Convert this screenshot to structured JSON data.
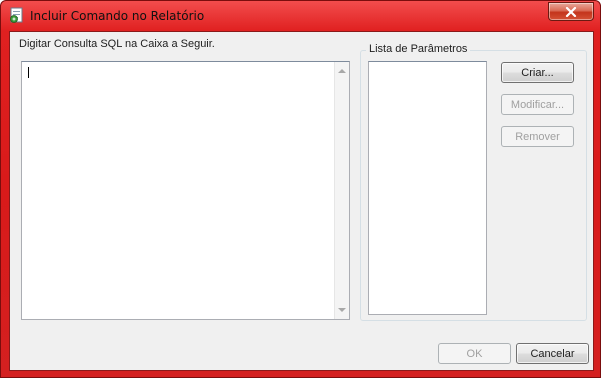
{
  "window": {
    "title": "Incluir Comando no Relatório",
    "app_icon": "report-icon",
    "close_icon": "close-icon"
  },
  "sql": {
    "label": "Digitar Consulta SQL na Caixa a Seguir.",
    "value": ""
  },
  "parameters": {
    "group_label": "Lista de Parâmetros",
    "items": []
  },
  "buttons": {
    "create": "Criar...",
    "modify": "Modificar...",
    "remove": "Remover",
    "ok": "OK",
    "cancel": "Cancelar"
  },
  "colors": {
    "titlebar": "#d91a1a",
    "client": "#f0f0f0",
    "close_button": "#c4341c"
  }
}
